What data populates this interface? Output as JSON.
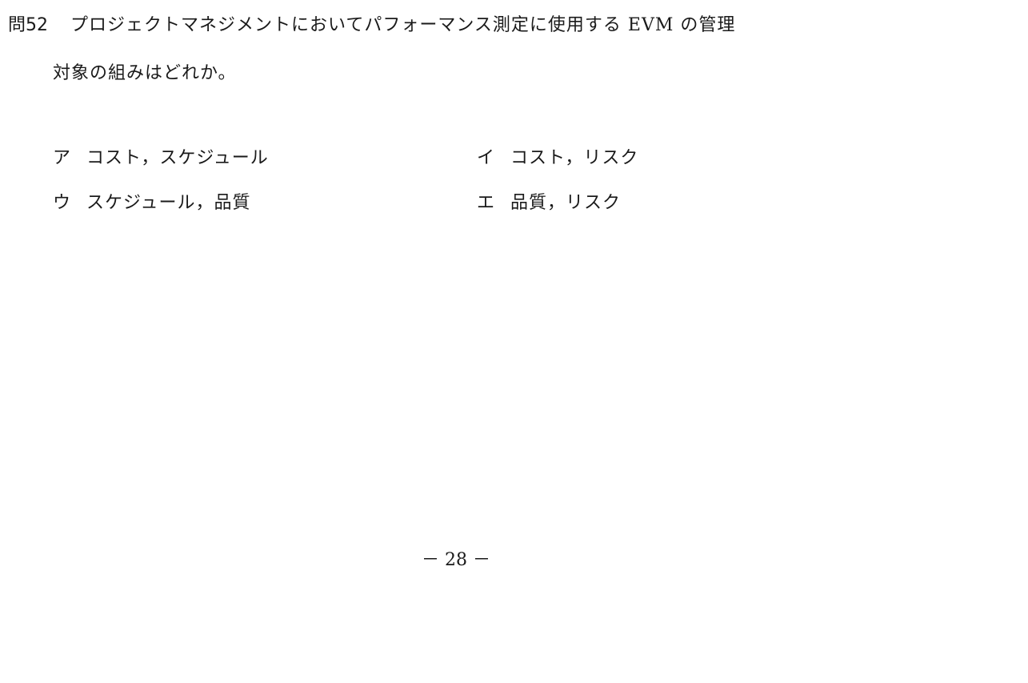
{
  "question": {
    "number": "問52",
    "line1": "プロジェクトマネジメントにおいてパフォーマンス測定に使用する EVM の管理",
    "line2": "対象の組みはどれか。"
  },
  "choices": [
    {
      "marker": "ア",
      "text": "コスト，スケジュール"
    },
    {
      "marker": "イ",
      "text": "コスト，リスク"
    },
    {
      "marker": "ウ",
      "text": "スケジュール，品質"
    },
    {
      "marker": "エ",
      "text": "品質，リスク"
    }
  ],
  "footer": {
    "page_number": "－ 28 －"
  }
}
